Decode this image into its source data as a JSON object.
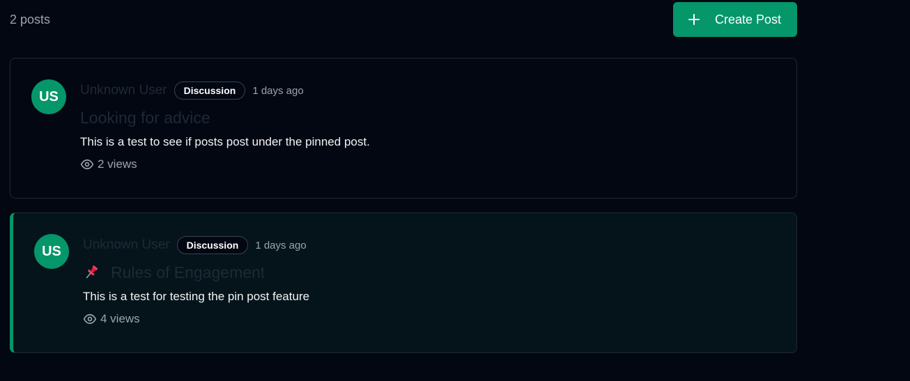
{
  "header": {
    "post_count": "2 posts",
    "create_button_label": "Create Post",
    "create_button_icon": "plus-icon"
  },
  "colors": {
    "accent": "#059669",
    "background": "#030712",
    "pinned_background": "#04141a"
  },
  "posts": [
    {
      "avatar_initials": "US",
      "author": "Unknown User",
      "category": "Discussion",
      "time": "1 days ago",
      "title": "Looking for advice",
      "body": "This is a test to see if posts post under the pinned post.",
      "views": "2 views",
      "pinned": false
    },
    {
      "avatar_initials": "US",
      "author": "Unknown User",
      "category": "Discussion",
      "time": "1 days ago",
      "title": "Rules of Engagement",
      "body": "This is a test for testing the pin post feature",
      "views": "4 views",
      "pinned": true,
      "pin_icon": "pushpin-icon"
    }
  ]
}
